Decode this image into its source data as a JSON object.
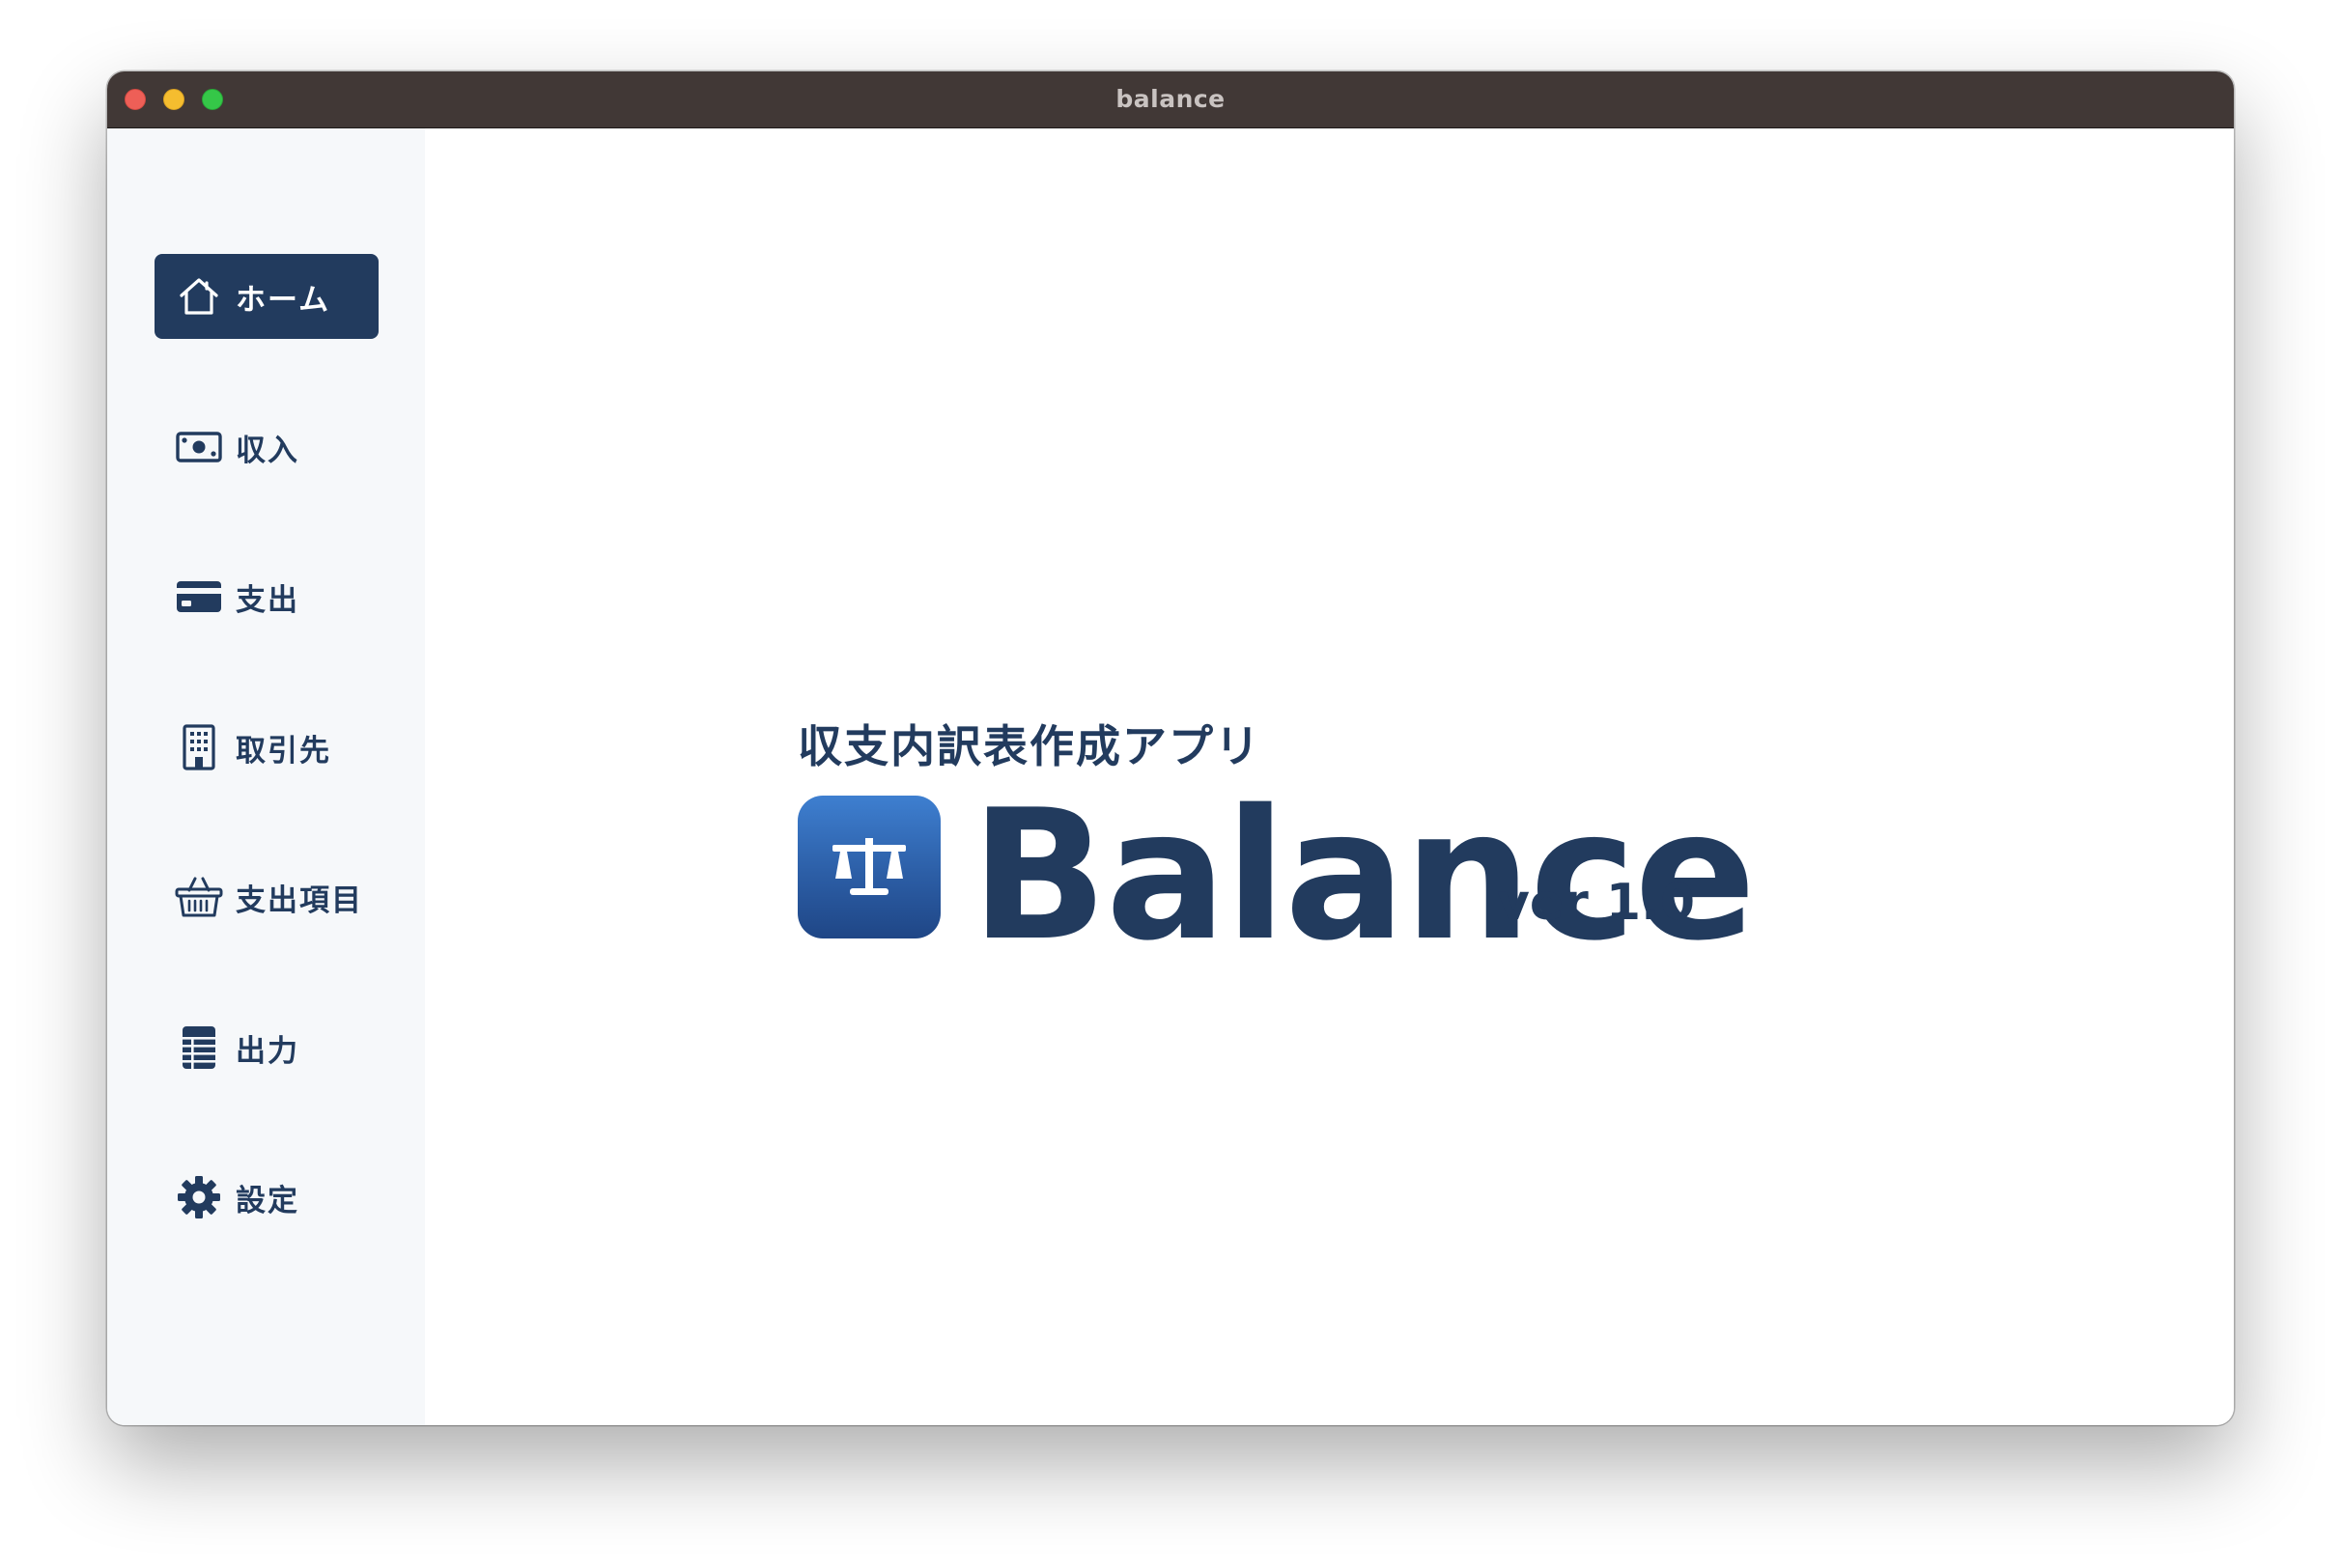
{
  "window": {
    "title": "balance"
  },
  "sidebar": {
    "items": [
      {
        "label": "ホーム",
        "icon": "home-icon",
        "active": true
      },
      {
        "label": "収入",
        "icon": "cash-icon",
        "active": false
      },
      {
        "label": "支出",
        "icon": "credit-card-icon",
        "active": false
      },
      {
        "label": "取引先",
        "icon": "building-icon",
        "active": false
      },
      {
        "label": "支出項目",
        "icon": "basket-icon",
        "active": false
      },
      {
        "label": "出力",
        "icon": "table-icon",
        "active": false
      },
      {
        "label": "設定",
        "icon": "gear-icon",
        "active": false
      }
    ]
  },
  "main": {
    "subtitle": "収支内訳表作成アプリ",
    "app_name": "Balance",
    "version": "ver 1.0",
    "app_icon": "balance-scale-icon"
  },
  "colors": {
    "brand_navy": "#223b5e",
    "sidebar_bg": "#f6f8fa",
    "titlebar_bg": "#413836",
    "icon_gradient_top": "#3e7fd0",
    "icon_gradient_bottom": "#1f4686"
  }
}
